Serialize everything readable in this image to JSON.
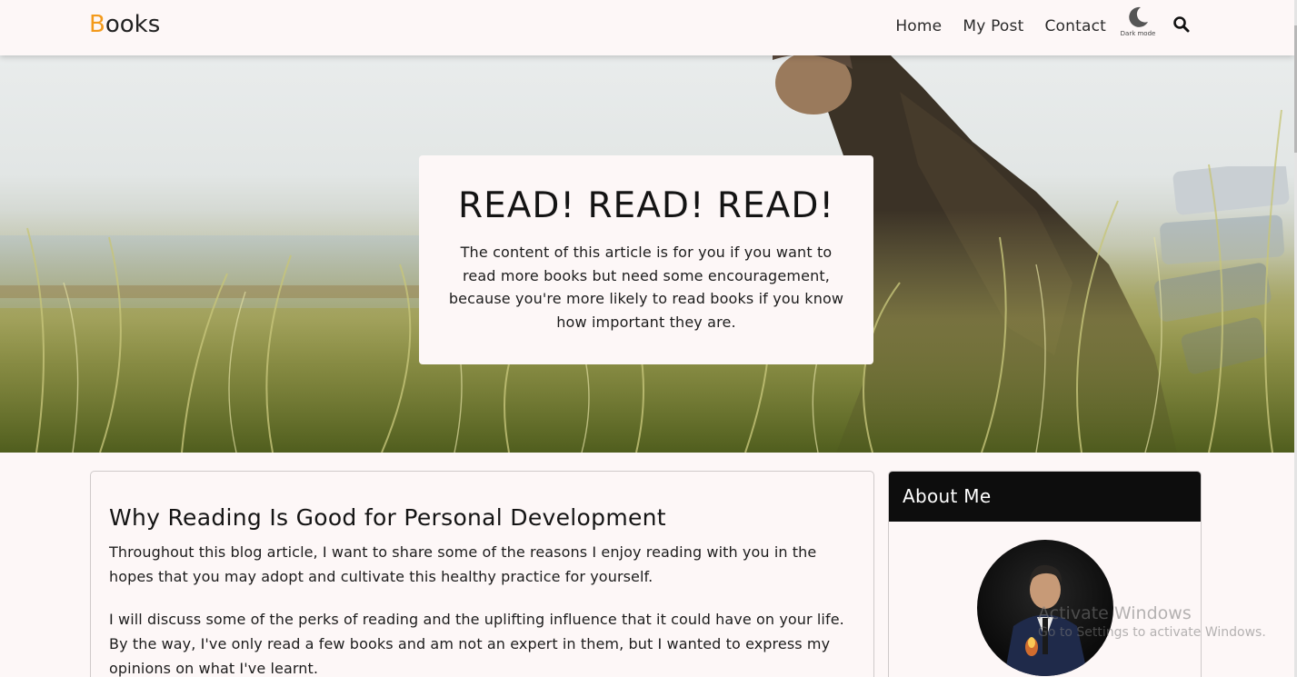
{
  "navbar": {
    "brand_first": "B",
    "brand_rest": "ooks",
    "links": [
      "Home",
      "My Post",
      "Contact"
    ],
    "dark_mode_label": "Dark mode"
  },
  "hero": {
    "title": "READ! READ! READ!",
    "text": "The content of this article is for you if you want to read more books but need some encouragement, because you're more likely to read books if you know how important they are."
  },
  "article": {
    "title": "Why Reading Is Good for Personal Development",
    "paragraphs": [
      "Throughout this blog article, I want to share some of the reasons I enjoy reading with you in the hopes that you may adopt and cultivate this healthy practice for yourself.",
      "I will discuss some of the perks of reading and the uplifting influence that it could have on your life. By the way, I've only read a few books and am not an expert in them, but I wanted to express my opinions on what I've learnt."
    ]
  },
  "sidebar": {
    "title": "About Me"
  },
  "watermark": {
    "line1": "Activate Windows",
    "line2": "Go to Settings to activate Windows."
  },
  "colors": {
    "brand_accent": "#f39a1b",
    "page_bg": "#fdf7f7",
    "sidebar_header": "#0d0d0d"
  }
}
